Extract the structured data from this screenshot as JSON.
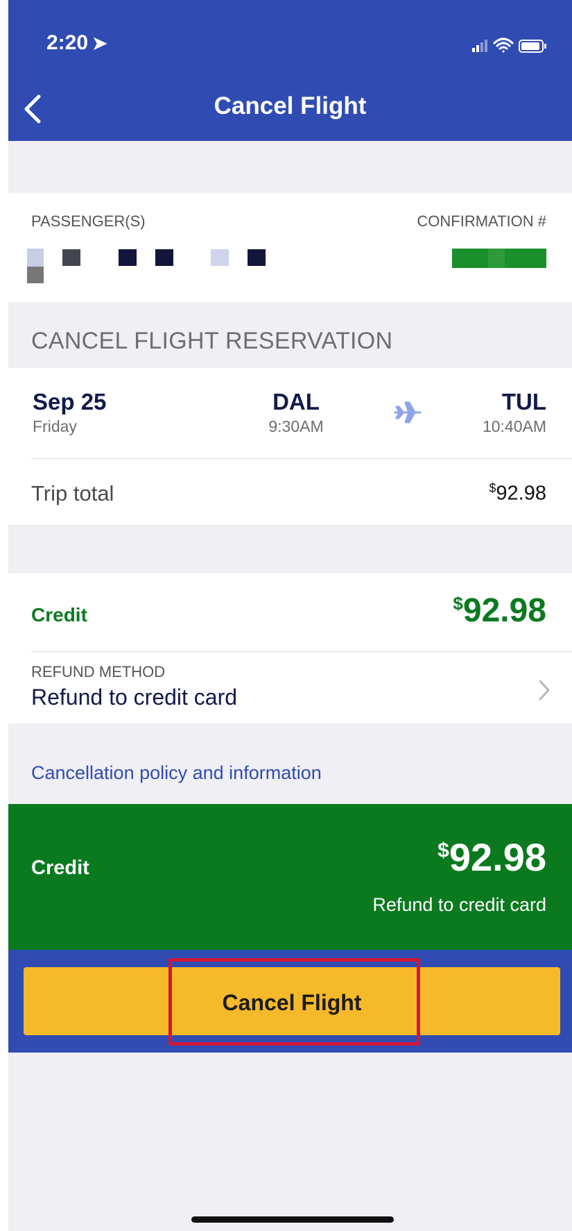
{
  "status_bar": {
    "time": "2:20",
    "location_glyph": "➤"
  },
  "nav": {
    "title": "Cancel Flight"
  },
  "passengers": {
    "label": "PASSENGER(S)",
    "confirmation_label": "CONFIRMATION #"
  },
  "cancel_section": {
    "title": "CANCEL FLIGHT RESERVATION"
  },
  "flight": {
    "date": "Sep 25",
    "weekday": "Friday",
    "origin_code": "DAL",
    "depart_time": "9:30AM",
    "dest_code": "TUL",
    "arrive_time": "10:40AM"
  },
  "trip_total": {
    "label": "Trip total",
    "currency": "$",
    "amount": "92.98"
  },
  "credit": {
    "label": "Credit",
    "currency": "$",
    "amount": "92.98"
  },
  "refund": {
    "label": "REFUND METHOD",
    "value": "Refund to credit card"
  },
  "policy_link": "Cancellation policy and information",
  "summary": {
    "label": "Credit",
    "currency": "$",
    "amount": "92.98",
    "note": "Refund to credit card"
  },
  "cta": {
    "label": "Cancel Flight"
  },
  "colors": {
    "brand_blue": "#304cb2",
    "credit_green": "#0b7a1f",
    "cta_yellow": "#f6b92a",
    "highlight_red": "#d0173a",
    "link_blue": "#304cb2"
  },
  "icons": [
    "location-arrow-icon",
    "signal-icon",
    "wifi-icon",
    "battery-icon",
    "back-chevron-icon",
    "airplane-icon",
    "chevron-right-icon"
  ]
}
